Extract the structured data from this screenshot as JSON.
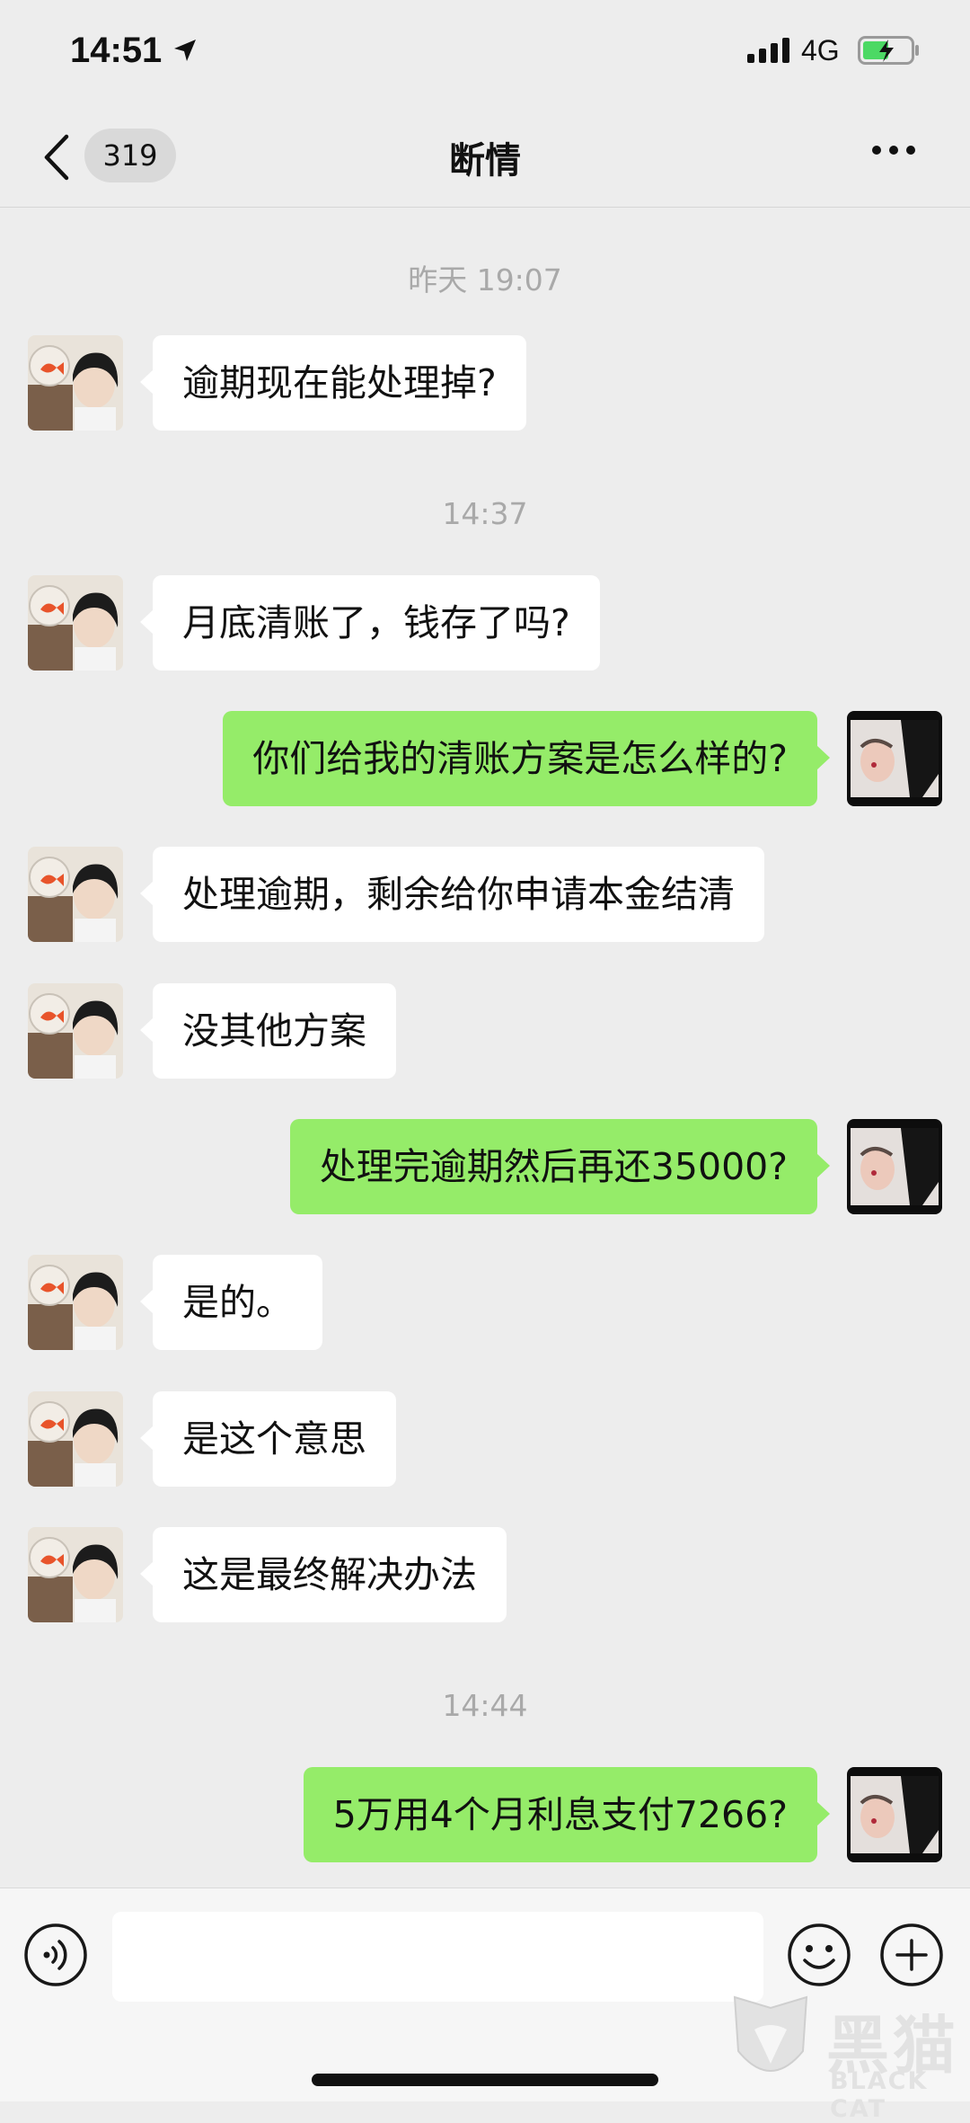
{
  "status_bar": {
    "time": "14:51",
    "network": "4G"
  },
  "nav": {
    "back_count": "319",
    "title": "断情"
  },
  "messages": [
    {
      "timestamp": "昨天 19:07"
    },
    {
      "side": "left",
      "text": "逾期现在能处理掉?"
    },
    {
      "timestamp": "14:37"
    },
    {
      "side": "left",
      "text": "月底清账了，钱存了吗?"
    },
    {
      "side": "right",
      "text": "你们给我的清账方案是怎么样的?"
    },
    {
      "side": "left",
      "text": "处理逾期，剩余给你申请本金结清"
    },
    {
      "side": "left",
      "text": "没其他方案"
    },
    {
      "side": "right",
      "text": "处理完逾期然后再还35000?"
    },
    {
      "side": "left",
      "text": "是的。"
    },
    {
      "side": "left",
      "text": "是这个意思"
    },
    {
      "side": "left",
      "text": "这是最终解决办法"
    },
    {
      "timestamp": "14:44"
    },
    {
      "side": "right",
      "text": "5万用4个月利息支付7266?"
    }
  ],
  "watermark": {
    "cn": "黑猫",
    "en": "BLACK CAT"
  },
  "colors": {
    "background": "#ededed",
    "bubble_self": "#95ec69",
    "bubble_other": "#ffffff",
    "timestamp": "#a9a9a9"
  }
}
